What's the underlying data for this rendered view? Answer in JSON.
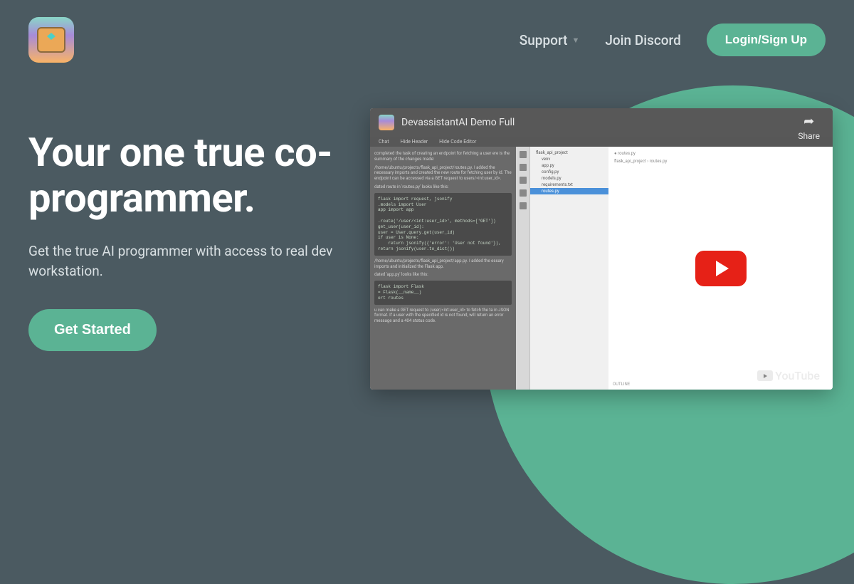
{
  "nav": {
    "support": "Support",
    "discord": "Join Discord",
    "login": "Login/Sign Up"
  },
  "hero": {
    "headline": "Your one true co-programmer.",
    "subhead": "Get the true AI programmer with access to real dev workstation.",
    "cta": "Get Started"
  },
  "video": {
    "title": "DevassistantAI Demo Full",
    "share": "Share",
    "menu": {
      "chat": "Chat",
      "hide_header": "Hide Header",
      "hide_code": "Hide Code Editor"
    },
    "summary_text": "completed the task of creating an endpoint for fetching a user ere is the summary of the changes made:",
    "path_text": "/home/ubuntu/projects/flask_api_project/routes.py. I added the necessary imports and created the new route for fetching user by id. The endpoint can be accessed via a GET request to users/<int:user_id>.",
    "route_label": "dated route in 'routes.py' looks like this:",
    "code1": "flask import request, jsonify\n.models import User\napp import app\n\n.route('/user/<int:user_id>', methods=['GET'])\nget_user(user_id):\nuser = User.query.get(user_id)\nif user is None:\n    return jsonify({'error': 'User not found'}),\nreturn jsonify(user.to_dict())",
    "app_path": "/home/ubuntu/projects/flask_api_project/app.py. I added the essary imports and initialized the Flask app.",
    "app_label": "dated 'app.py' looks like this:",
    "code2": "flask import Flask\n= Flask(__name__)\nort routes",
    "footer_text": "u can make a GET request to /user/<int:user_id> to fetch the ta in JSON format. If a user with the specified id is not found, will return an error message and a 404 status code.",
    "tree": {
      "root": "flask_api_project",
      "items": [
        "venv",
        "app.py",
        "config.py",
        "models.py",
        "requirements.txt",
        "routes.py"
      ]
    },
    "breadcrumb": "flask_api_project › routes.py",
    "tab": "routes.py",
    "outline": "OUTLINE",
    "youtube": "YouTube"
  }
}
